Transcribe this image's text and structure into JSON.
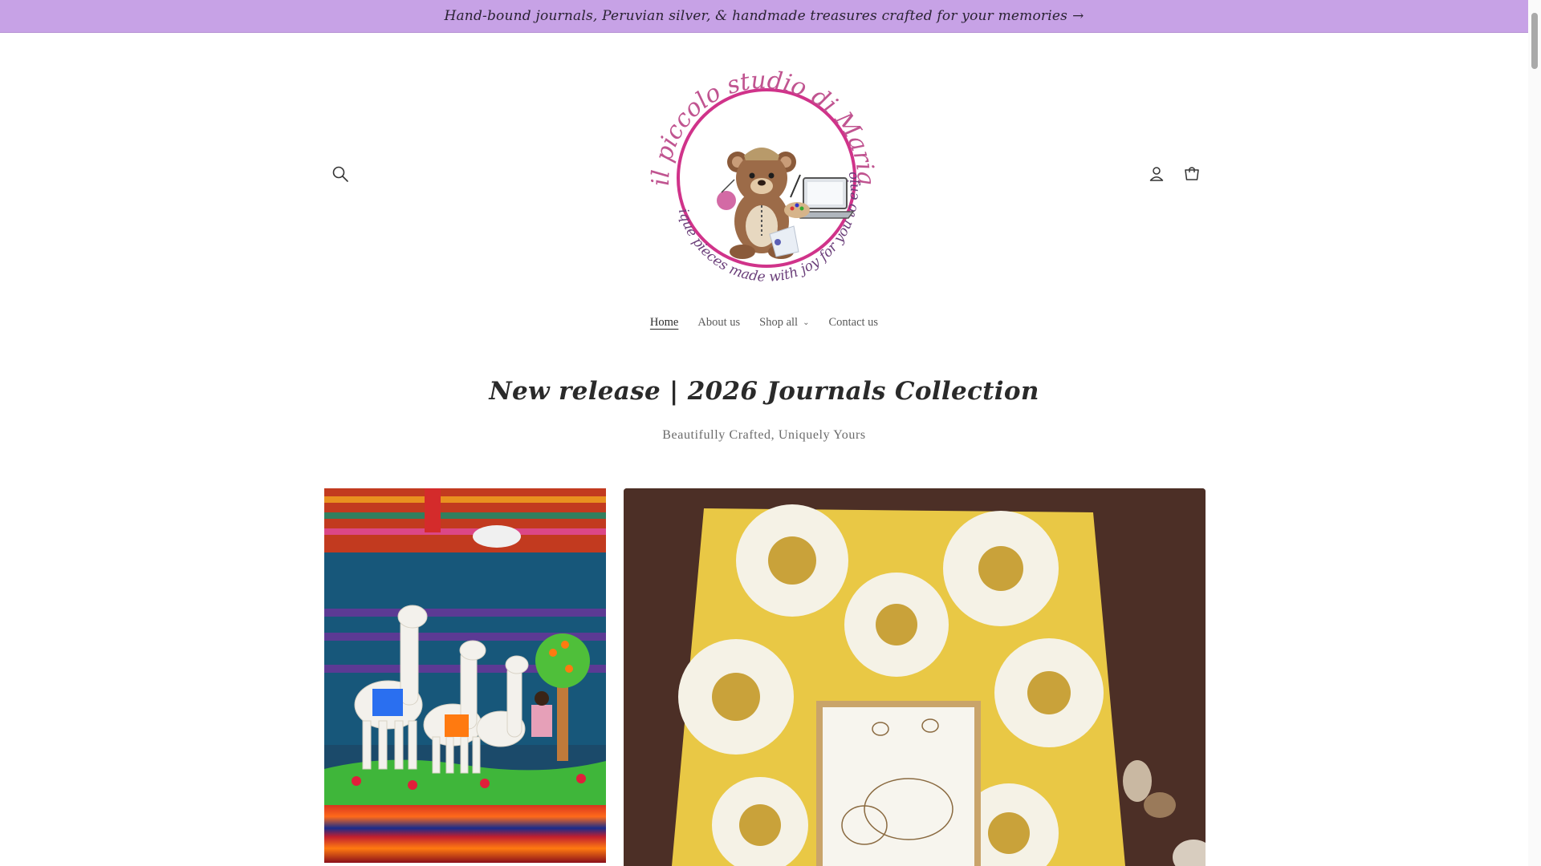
{
  "announcement": {
    "text": "Hand-bound journals, Peruvian silver, & handmade treasures crafted for your memories",
    "arrow": "→"
  },
  "header": {
    "search_icon": "search-icon",
    "account_icon": "account-icon",
    "cart_icon": "cart-icon",
    "logo": {
      "arc_top": "il piccolo studio di Maria",
      "arc_bottom": "Unique pieces made with joy for you to enjoy!"
    }
  },
  "nav": {
    "items": [
      {
        "label": "Home",
        "active": true
      },
      {
        "label": "About us",
        "active": false
      },
      {
        "label": "Shop all",
        "active": false,
        "has_dropdown": true
      },
      {
        "label": "Contact us",
        "active": false
      }
    ]
  },
  "hero": {
    "title": "New release | 2026 Journals Collection",
    "subtitle": "Beautifully Crafted, Uniquely Yours"
  },
  "colors": {
    "announcement_bg": "#c7a2e6",
    "logo_ring": "#d0338a",
    "logo_text": "#6b3f7a"
  }
}
